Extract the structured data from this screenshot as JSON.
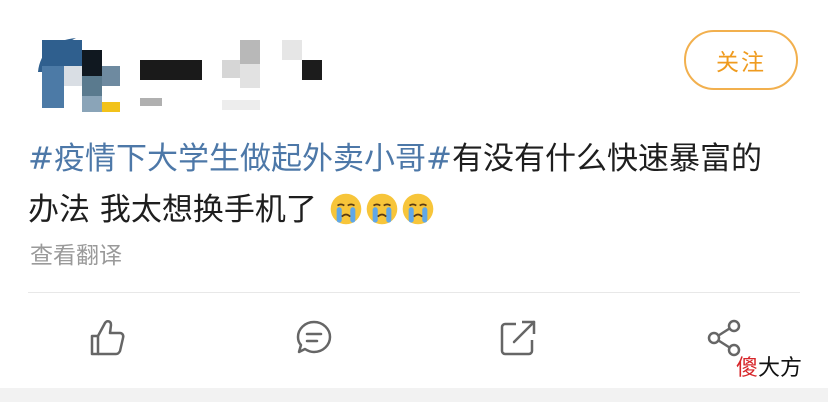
{
  "post": {
    "hashtag": "#疫情下大学生做起外卖小哥#",
    "text_line1": "有没有什么快速暴富的",
    "text_line2": "办法 我太想换手机了",
    "emojis": [
      "crying-face",
      "crying-face",
      "crying-face"
    ]
  },
  "follow_button": {
    "label": "关注"
  },
  "translate_link": {
    "label": "查看翻译"
  },
  "actions": [
    {
      "name": "like",
      "icon": "thumbs-up-icon"
    },
    {
      "name": "comment",
      "icon": "comment-icon"
    },
    {
      "name": "repost",
      "icon": "repost-icon"
    },
    {
      "name": "share",
      "icon": "share-icon"
    }
  ],
  "watermark": {
    "red": "傻",
    "black": "大方"
  },
  "colors": {
    "accent": "#ef9b1f",
    "hashtag": "#4d78a8",
    "text": "#1e1e1e",
    "muted": "#9a9a9a",
    "icon": "#666666"
  }
}
